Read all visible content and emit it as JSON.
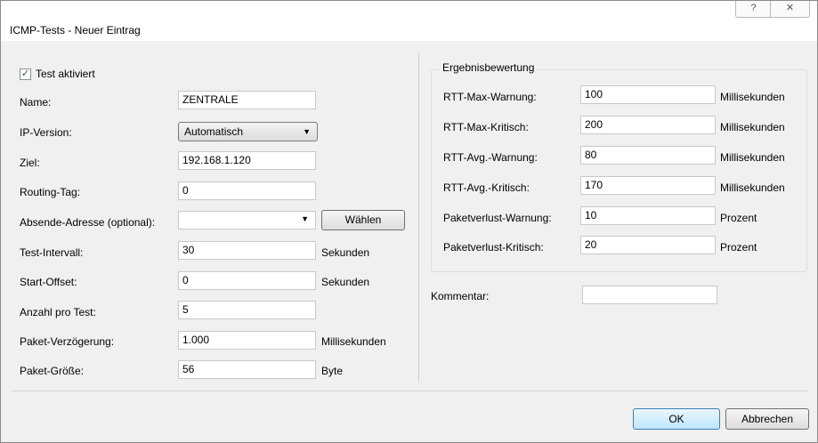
{
  "window": {
    "title": "ICMP-Tests - Neuer Eintrag",
    "help_glyph": "?",
    "close_glyph": "✕"
  },
  "left": {
    "test_enabled": {
      "label": "Test aktiviert",
      "checked": true
    },
    "name": {
      "label": "Name:",
      "value": "ZENTRALE"
    },
    "ip_version": {
      "label": "IP-Version:",
      "value": "Automatisch"
    },
    "target": {
      "label": "Ziel:",
      "value": "192.168.1.120"
    },
    "routing_tag": {
      "label": "Routing-Tag:",
      "value": "0"
    },
    "sender_address": {
      "label": "Absende-Adresse (optional):",
      "value": "",
      "button": "Wählen"
    },
    "test_interval": {
      "label": "Test-Intervall:",
      "value": "30",
      "unit": "Sekunden"
    },
    "start_offset": {
      "label": "Start-Offset:",
      "value": "0",
      "unit": "Sekunden"
    },
    "count_per_test": {
      "label": "Anzahl pro Test:",
      "value": "5"
    },
    "packet_delay": {
      "label": "Paket-Verzögerung:",
      "value": "1.000",
      "unit": "Millisekunden"
    },
    "packet_size": {
      "label": "Paket-Größe:",
      "value": "56",
      "unit": "Byte"
    }
  },
  "evaluation": {
    "title": "Ergebnisbewertung",
    "rtt_max_warn": {
      "label": "RTT-Max-Warnung:",
      "value": "100",
      "unit": "Millisekunden"
    },
    "rtt_max_crit": {
      "label": "RTT-Max-Kritisch:",
      "value": "200",
      "unit": "Millisekunden"
    },
    "rtt_avg_warn": {
      "label": "RTT-Avg.-Warnung:",
      "value": "80",
      "unit": "Millisekunden"
    },
    "rtt_avg_crit": {
      "label": "RTT-Avg.-Kritisch:",
      "value": "170",
      "unit": "Millisekunden"
    },
    "loss_warn": {
      "label": "Paketverlust-Warnung:",
      "value": "10",
      "unit": "Prozent"
    },
    "loss_crit": {
      "label": "Paketverlust-Kritisch:",
      "value": "20",
      "unit": "Prozent"
    }
  },
  "comment": {
    "label": "Kommentar:",
    "value": ""
  },
  "footer": {
    "ok": "OK",
    "cancel": "Abbrechen"
  }
}
